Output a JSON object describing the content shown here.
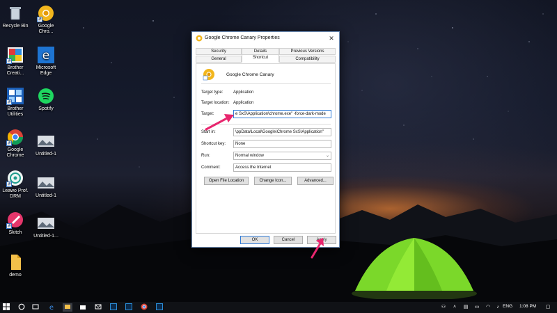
{
  "desktop": {
    "icons": [
      {
        "label": "Recycle Bin",
        "icon": "recycle-bin-icon"
      },
      {
        "label": "Google Chro...",
        "icon": "chrome-canary-icon"
      },
      {
        "label": "Brother Creati...",
        "icon": "brother-creative-icon"
      },
      {
        "label": "Microsoft Edge",
        "icon": "edge-icon"
      },
      {
        "label": "Brother Utilities",
        "icon": "brother-utilities-icon"
      },
      {
        "label": "Spotify",
        "icon": "spotify-icon"
      },
      {
        "label": "Google Chrome",
        "icon": "chrome-icon"
      },
      {
        "label": "Untitled-1",
        "icon": "image-file-icon"
      },
      {
        "label": "Leawo Prof. DRM",
        "icon": "leawo-icon"
      },
      {
        "label": "Untitled-1",
        "icon": "image-file-icon"
      },
      {
        "label": "Skitch",
        "icon": "skitch-icon"
      },
      {
        "label": "Untitled-1...",
        "icon": "image-file-icon"
      },
      {
        "label": "demo",
        "icon": "file-icon"
      }
    ]
  },
  "dialog": {
    "title": "Google Chrome Canary Properties",
    "close_glyph": "✕",
    "tabs_row1": [
      "Security",
      "Details",
      "Previous Versions"
    ],
    "tabs_row2": [
      "General",
      "Shortcut",
      "Compatibility"
    ],
    "active_tab": "Shortcut",
    "app_name": "Google Chrome Canary",
    "fields": {
      "target_type_label": "Target type:",
      "target_type_value": "Application",
      "target_location_label": "Target location:",
      "target_location_value": "Application",
      "target_label": "Target:",
      "target_value": "e SxS\\Application\\chrome.exe\" -force-dark-mode",
      "start_in_label": "Start in:",
      "start_in_value": "\\ppData\\Local\\Google\\Chrome SxS\\Application\"",
      "shortcut_key_label": "Shortcut key:",
      "shortcut_key_value": "None",
      "run_label": "Run:",
      "run_value": "Normal window",
      "comment_label": "Comment:",
      "comment_value": "Access the Internet"
    },
    "buttons": {
      "open_file_location": "Open File Location",
      "change_icon": "Change Icon...",
      "advanced": "Advanced...",
      "ok": "OK",
      "cancel": "Cancel",
      "apply": "Apply"
    }
  },
  "taskbar": {
    "language": "ENG",
    "time": "1:08 PM"
  },
  "colors": {
    "accent": "#2f7ad6",
    "annotation_arrow": "#e8266e",
    "taskbar": "#101216"
  }
}
